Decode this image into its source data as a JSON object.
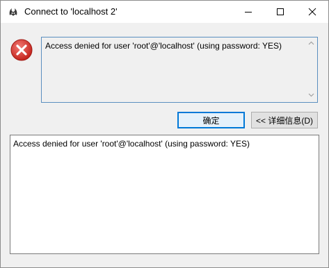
{
  "window": {
    "title": "Connect to 'localhost 2'",
    "app_icon": "navicat-icon",
    "controls": [
      "minimize-icon",
      "maximize-icon",
      "close-icon"
    ]
  },
  "dialog": {
    "icon": "error-icon",
    "message": "Access denied for user 'root'@'localhost' (using password: YES)",
    "ok_label": "确定",
    "details_label": "<< 详细信息(D)",
    "details_text": "Access denied for user 'root'@'localhost' (using password: YES)"
  },
  "colors": {
    "error_red": "#d9332c",
    "focus_blue": "#0078d7",
    "message_border": "#5a8ebf"
  }
}
